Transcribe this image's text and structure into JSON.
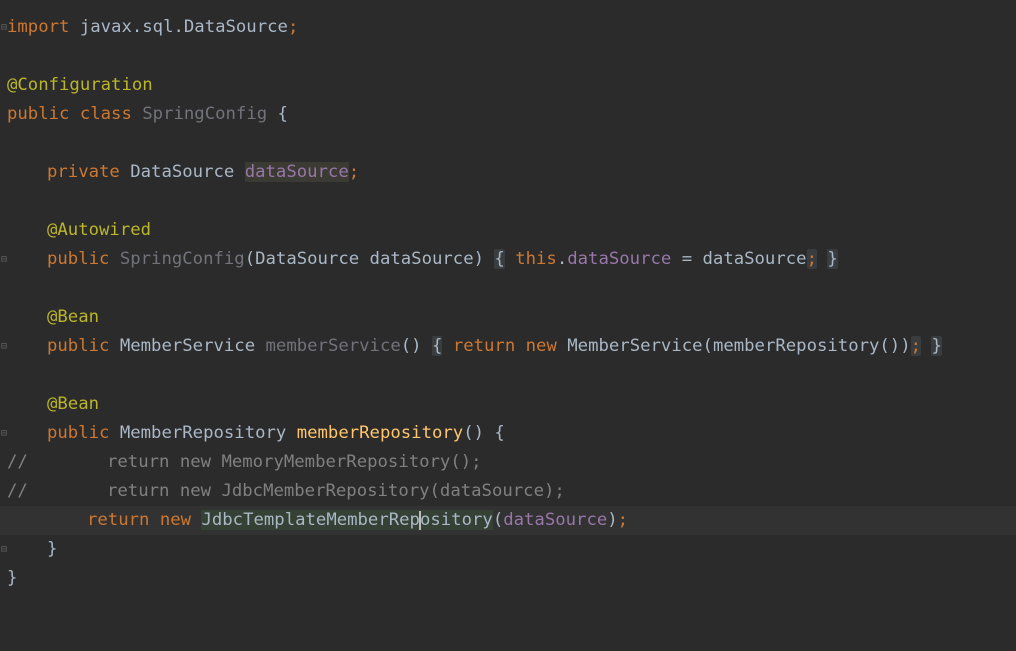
{
  "editor": {
    "colors": {
      "background": "#2b2b2b",
      "current_line": "#323232",
      "keyword": "#cc7832",
      "annotation": "#bbb529",
      "field": "#9876aa",
      "method_decl": "#ffc66d",
      "unused": "#72737a",
      "comment": "#808080",
      "text": "#a9b7c6"
    },
    "lines": [
      {
        "import_kw": "import",
        "import_path": " javax.sql.DataSource",
        "semi": ";"
      },
      {},
      {
        "annotation": "@Configuration"
      },
      {
        "public": "public",
        "class_kw": "class",
        "class_name": "SpringConfig",
        "brace": "{"
      },
      {},
      {
        "private": "private",
        "type": "DataSource",
        "name": "dataSource",
        "semi": ";"
      },
      {},
      {
        "annotation": "@Autowired"
      },
      {
        "public": "public",
        "ctor": "SpringConfig",
        "params": "(DataSource dataSource)",
        "open": "{",
        "this_kw": "this",
        "dot": ".",
        "field": "dataSource",
        "assign": " = dataSource",
        "semi": ";",
        "close": "}"
      },
      {},
      {
        "annotation": "@Bean"
      },
      {
        "public": "public",
        "type": "MemberService",
        "method": "memberService",
        "parens": "()",
        "open": "{",
        "return_kw": "return",
        "new_kw": "new",
        "expr": "MemberService(memberRepository())",
        "semi": ";",
        "close": "}"
      },
      {},
      {
        "annotation": "@Bean"
      },
      {
        "public": "public",
        "type": "MemberRepository",
        "method": "memberRepository",
        "rest": "() {"
      },
      {
        "comment_marker": "//",
        "body": "return new MemoryMemberRepository();"
      },
      {
        "comment_marker": "//",
        "body": "return new JdbcMemberRepository(dataSource);"
      },
      {
        "return_kw": "return",
        "new_kw": "new",
        "class_a": "JdbcTemplateMemberRep",
        "class_b": "ository",
        "paren_open": "(",
        "arg": "dataSource",
        "paren_close": ")",
        "semi": ";"
      },
      {
        "brace": "}"
      },
      {
        "brace": "}"
      }
    ]
  }
}
